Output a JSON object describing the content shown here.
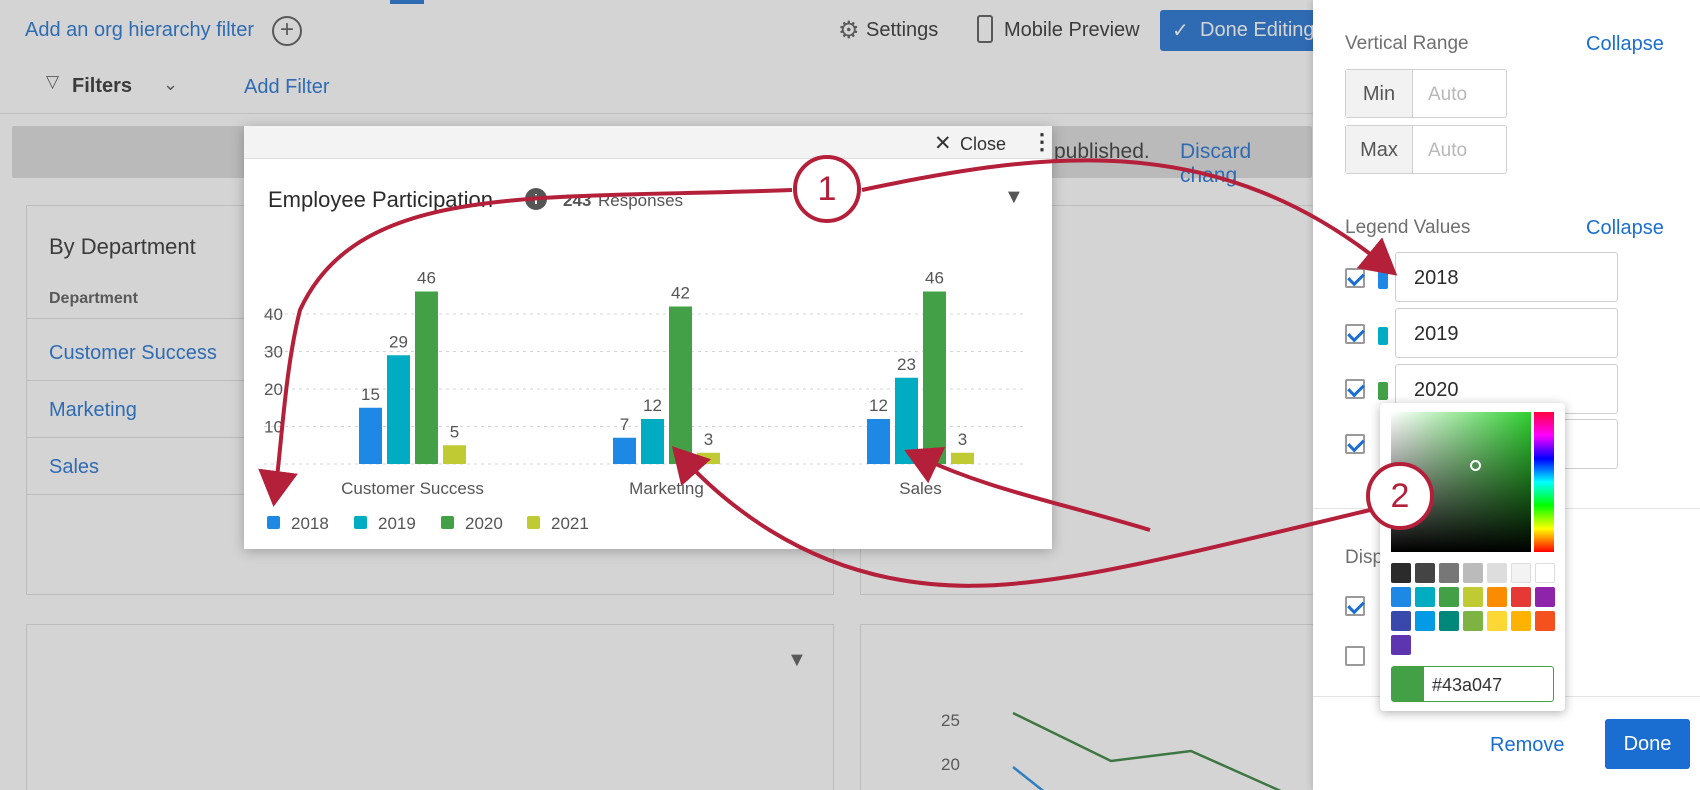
{
  "topbar": {
    "org_filter": "Add an org hierarchy filter",
    "settings": "Settings",
    "mobile_preview": "Mobile Preview",
    "done_editing": "Done Editing"
  },
  "filterbar": {
    "filters": "Filters",
    "add_filter": "Add Filter"
  },
  "pubbar": {
    "text": "published.",
    "discard": "Discard chang"
  },
  "bg_table": {
    "title": "By Department",
    "col_header": "Department",
    "rows": [
      "Customer Success",
      "Marketing",
      "Sales"
    ]
  },
  "bg_line": {
    "ticks": [
      "25",
      "20"
    ]
  },
  "modal": {
    "close": "Close",
    "title": "Employee Participation",
    "responses_count": "243",
    "responses_label": "Responses"
  },
  "chart_data": {
    "type": "bar",
    "categories": [
      "Customer Success",
      "Marketing",
      "Sales"
    ],
    "series": [
      {
        "name": "2018",
        "values": [
          15,
          7,
          12
        ],
        "color": "#1e88e5"
      },
      {
        "name": "2019",
        "values": [
          29,
          12,
          23
        ],
        "color": "#00acc1"
      },
      {
        "name": "2020",
        "values": [
          46,
          42,
          46
        ],
        "color": "#43a047"
      },
      {
        "name": "2021",
        "values": [
          5,
          3,
          3
        ],
        "color": "#c0ca33"
      }
    ],
    "yticks": [
      "10",
      "20",
      "30",
      "40"
    ],
    "ylim": [
      0,
      50
    ],
    "grid": true,
    "legend": "bottom-left"
  },
  "panel": {
    "vertical_range": "Vertical Range",
    "collapse": "Collapse",
    "min_label": "Min",
    "max_label": "Max",
    "min_placeholder": "Auto",
    "max_placeholder": "Auto",
    "legend_values": "Legend Values",
    "legend_collapse": "Collapse",
    "legend": [
      "2018",
      "2019",
      "2020"
    ],
    "display_partial": "Disp",
    "remove": "Remove",
    "done": "Done"
  },
  "picker": {
    "hex": "#43a047",
    "swatches": [
      "#2b2b2b",
      "#444444",
      "#777777",
      "#bbbbbb",
      "#dddddd",
      "#f3f3f3",
      "#ffffff",
      "#1e88e5",
      "#00acc1",
      "#43a047",
      "#c0ca33",
      "#fb8c00",
      "#e53935",
      "#8e24aa",
      "#3949ab",
      "#039be5",
      "#00897b",
      "#7cb342",
      "#fdd835",
      "#ffb300",
      "#f4511e",
      "#5e35b1"
    ]
  },
  "annotations": {
    "one": "1",
    "two": "2"
  }
}
